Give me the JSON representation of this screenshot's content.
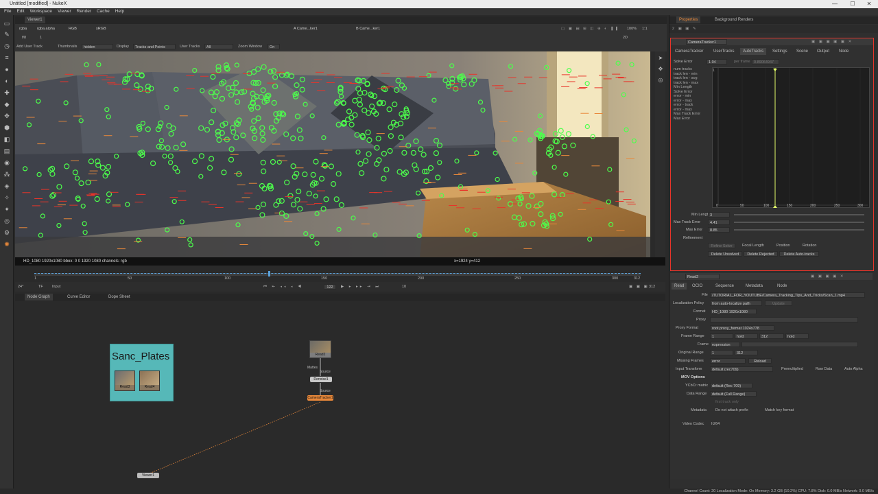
{
  "window": {
    "title": "Untitled [modified] - NukeX",
    "controls": [
      "—",
      "☐",
      "✕"
    ]
  },
  "menu": [
    "File",
    "Edit",
    "Workspace",
    "Viewer",
    "Render",
    "Cache",
    "Help"
  ],
  "viewer": {
    "tab": "Viewer1",
    "channels": "rgba",
    "channel_alpha": "rgba.alpha",
    "color": "RGB",
    "lut": "sRGB",
    "input_a": "A  Came...ker1",
    "input_b": "B  Came...ker1",
    "zoom": "100%",
    "ratio": "1:1",
    "mode_2d": "2D",
    "fstop": "f/8",
    "frame_field": "1",
    "y_field": "1",
    "row3": {
      "add_user_track": "Add User Track",
      "thumbnails_label": "Thumbnails",
      "thumbnails_value": "hidden",
      "display_label": "Display",
      "display_value": "Tracks and Points",
      "user_tracks_label": "User Tracks",
      "user_tracks_value": "All",
      "zoom_window_label": "Zoom Window",
      "zoom_window_value": "On"
    },
    "info_left": "HD_1080 1920x1080  bbox: 0 0 1920 1080 channels: rgb",
    "info_center": "x=1924 y=412"
  },
  "timeline": {
    "fps": "24*",
    "tf": "TF",
    "range": "Input",
    "ticks": [
      "1",
      "50",
      "100",
      "150",
      "200",
      "250",
      "300",
      "312"
    ],
    "current_frame": "122",
    "step": "10",
    "end_frame": "312",
    "start_frame": "1"
  },
  "bottom_tabs": [
    "Node Graph",
    "Curve Editor",
    "Dope Sheet"
  ],
  "nodes": {
    "backdrop": "Sanc_Plates",
    "read3": "Read3",
    "read4": "Read4",
    "read2": "Read2",
    "denoise": "Denoise1",
    "tracker": "CameraTracker1",
    "viewer": "Viewer1",
    "edge_source": "Source",
    "edge_source2": "Source",
    "edge_mattes": "Mattes"
  },
  "properties": {
    "tabs": [
      "Properties",
      "Background Renders"
    ],
    "camera_tracker": {
      "name": "CameraTracker1",
      "tabs": [
        "CameraTracker",
        "UserTracks",
        "AutoTracks",
        "Settings",
        "Scene",
        "Output",
        "Node"
      ],
      "solve_error_label": "Solve Error",
      "solve_error": "1.04",
      "per_frame_label": "per frame",
      "per_frame": "0.89064947",
      "stats": [
        "num tracks",
        "track len - min",
        "track len - avg",
        "track len - max",
        "Min Length",
        "Solve Error",
        "error - min",
        "error - max",
        "error - track",
        "error - max",
        "Max Track Error",
        "Max Error"
      ],
      "graph_y_top": "1",
      "graph_x_ticks": [
        "0",
        "50",
        "100",
        "150",
        "200",
        "250",
        "300"
      ],
      "min_length_label": "Min Length",
      "min_length": "3",
      "max_track_error_label": "Max Track Error",
      "max_track_error": "4.41",
      "max_error_label": "Max Error",
      "max_error": "8.85",
      "refinement": "Refinement",
      "refine_buttons": [
        "Refine Solve",
        "Focal Length",
        "Position",
        "Rotation"
      ],
      "delete_buttons": [
        "Delete Unsolved",
        "Delete Rejected",
        "Delete Auto-tracks"
      ]
    },
    "read": {
      "name": "Read2",
      "tabs": [
        "Read",
        "OCIO",
        "Sequence",
        "Metadata",
        "Node"
      ],
      "file_label": "File",
      "file": "/TUTORIAL_FOR_YOUTUBE/Camera_Tracking_Tips_And_Tricks/Scan_1.mp4",
      "localization_label": "Localization Policy",
      "localization": "from auto-localize path",
      "update": "Update",
      "format_label": "Format",
      "format": "HD_1080 1920x1080",
      "proxy_label": "Proxy",
      "proxy_format_label": "Proxy Format",
      "proxy_format": "root.proxy_format 1024x778",
      "frame_range_label": "Frame Range",
      "frame_start": "1",
      "before": "hold",
      "frame_end": "312",
      "after": "hold",
      "frame_label": "Frame",
      "frame_mode": "expression",
      "original_range_label": "Original Range",
      "orig_start": "1",
      "orig_end": "312",
      "missing_label": "Missing Frames",
      "missing": "error",
      "reload": "Reload",
      "input_transform_label": "Input Transform",
      "input_transform": "default (rec709)",
      "premultiplied": "Premultiplied",
      "raw_data": "Raw Data",
      "auto_alpha": "Auto Alpha",
      "mov_options": "MOV Options",
      "ycbcr_label": "YCbCr matrix",
      "ycbcr": "default (Rec 709)",
      "data_range_label": "Data Range",
      "data_range": "default (Full Range)",
      "first_track_only": "first track only",
      "metadata_label": "Metadata",
      "do_not_attach": "Do not attach prefix",
      "match_key": "Match key format",
      "video_codec_label": "Video Codec",
      "video_codec": "h264"
    }
  },
  "status": "Channel Count: 20  Localization Mode: On  Memory: 3.2 GB (10.2%)  CPU: 7.8%  Disk: 0.0 MB/s  Network: 0.0 MB/s",
  "colors": {
    "accent_orange": "#e8883a",
    "track_green": "#4cff4c",
    "track_red": "#e8342a",
    "backdrop": "#56b8b8"
  }
}
